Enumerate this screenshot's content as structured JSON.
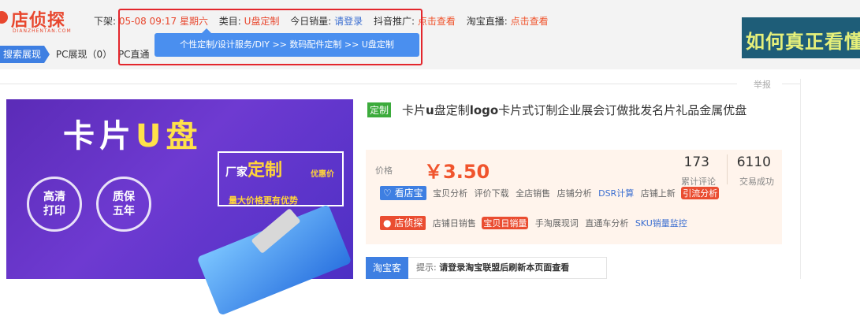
{
  "brand": {
    "name": "店侦探",
    "sub": "DIANZHENTAN.COM"
  },
  "header": {
    "listing_label": "下架:",
    "listing_time": "05-08 09:17 星期六",
    "category_label": "类目:",
    "category_value": "U盘定制",
    "sales_label": "今日销量:",
    "sales_value": "请登录",
    "douyin_label": "抖音推广:",
    "douyin_value": "点击查看",
    "taobao_live_label": "淘宝直播:",
    "taobao_live_value": "点击查看"
  },
  "row2": {
    "search_tag": "搜索展现",
    "pc_show": "PC展现（0）",
    "pc_direct": "PC直通"
  },
  "tooltip": {
    "text": "个性定制/设计服务/DIY >> 数码配件定制 >> U盘定制"
  },
  "banner": {
    "text": "如何真正看懂"
  },
  "report": "举报",
  "product_image": {
    "title_a": "卡片",
    "title_b": "U盘",
    "badge1_line1": "高清",
    "badge1_line2": "打印",
    "badge2_line1": "质保",
    "badge2_line2": "五年",
    "promo_prefix": "厂家",
    "promo_main": "定制",
    "promo_tag": "优惠价",
    "promo_sub": "量大价格更有优势"
  },
  "product": {
    "custom_badge": "定制",
    "title_part1": "卡片",
    "title_bold": "u",
    "title_part2": "盘定制",
    "title_bold2": "logo",
    "title_part3": "卡片式订制企业展会订做批发名片礼品金属优盘"
  },
  "price": {
    "label": "价格",
    "value": "￥3.50",
    "reviews_count": "173",
    "reviews_label": "累计评论",
    "deals_count": "6110",
    "deals_label": "交易成功"
  },
  "links1": {
    "button": "看店宝",
    "items": [
      "宝贝分析",
      "评价下载",
      "全店销售",
      "店铺分析"
    ],
    "dsr": "DSR计算",
    "new": "店铺上新",
    "traffic": "引流分析"
  },
  "links2": {
    "button": "店侦探",
    "items": [
      "店铺日销售"
    ],
    "daily": "宝贝日销量",
    "rest": [
      "手淘展现词",
      "直通车分析"
    ],
    "sku": "SKU销量监控"
  },
  "taoke": {
    "label": "淘宝客",
    "hint_prefix": "提示:",
    "hint": "请登录淘宝联盟后刷新本页面查看"
  },
  "colors": {
    "accent_red": "#e8472e",
    "accent_blue": "#3e7fe2",
    "price_orange": "#f0542d",
    "custom_green": "#3cab3c"
  }
}
